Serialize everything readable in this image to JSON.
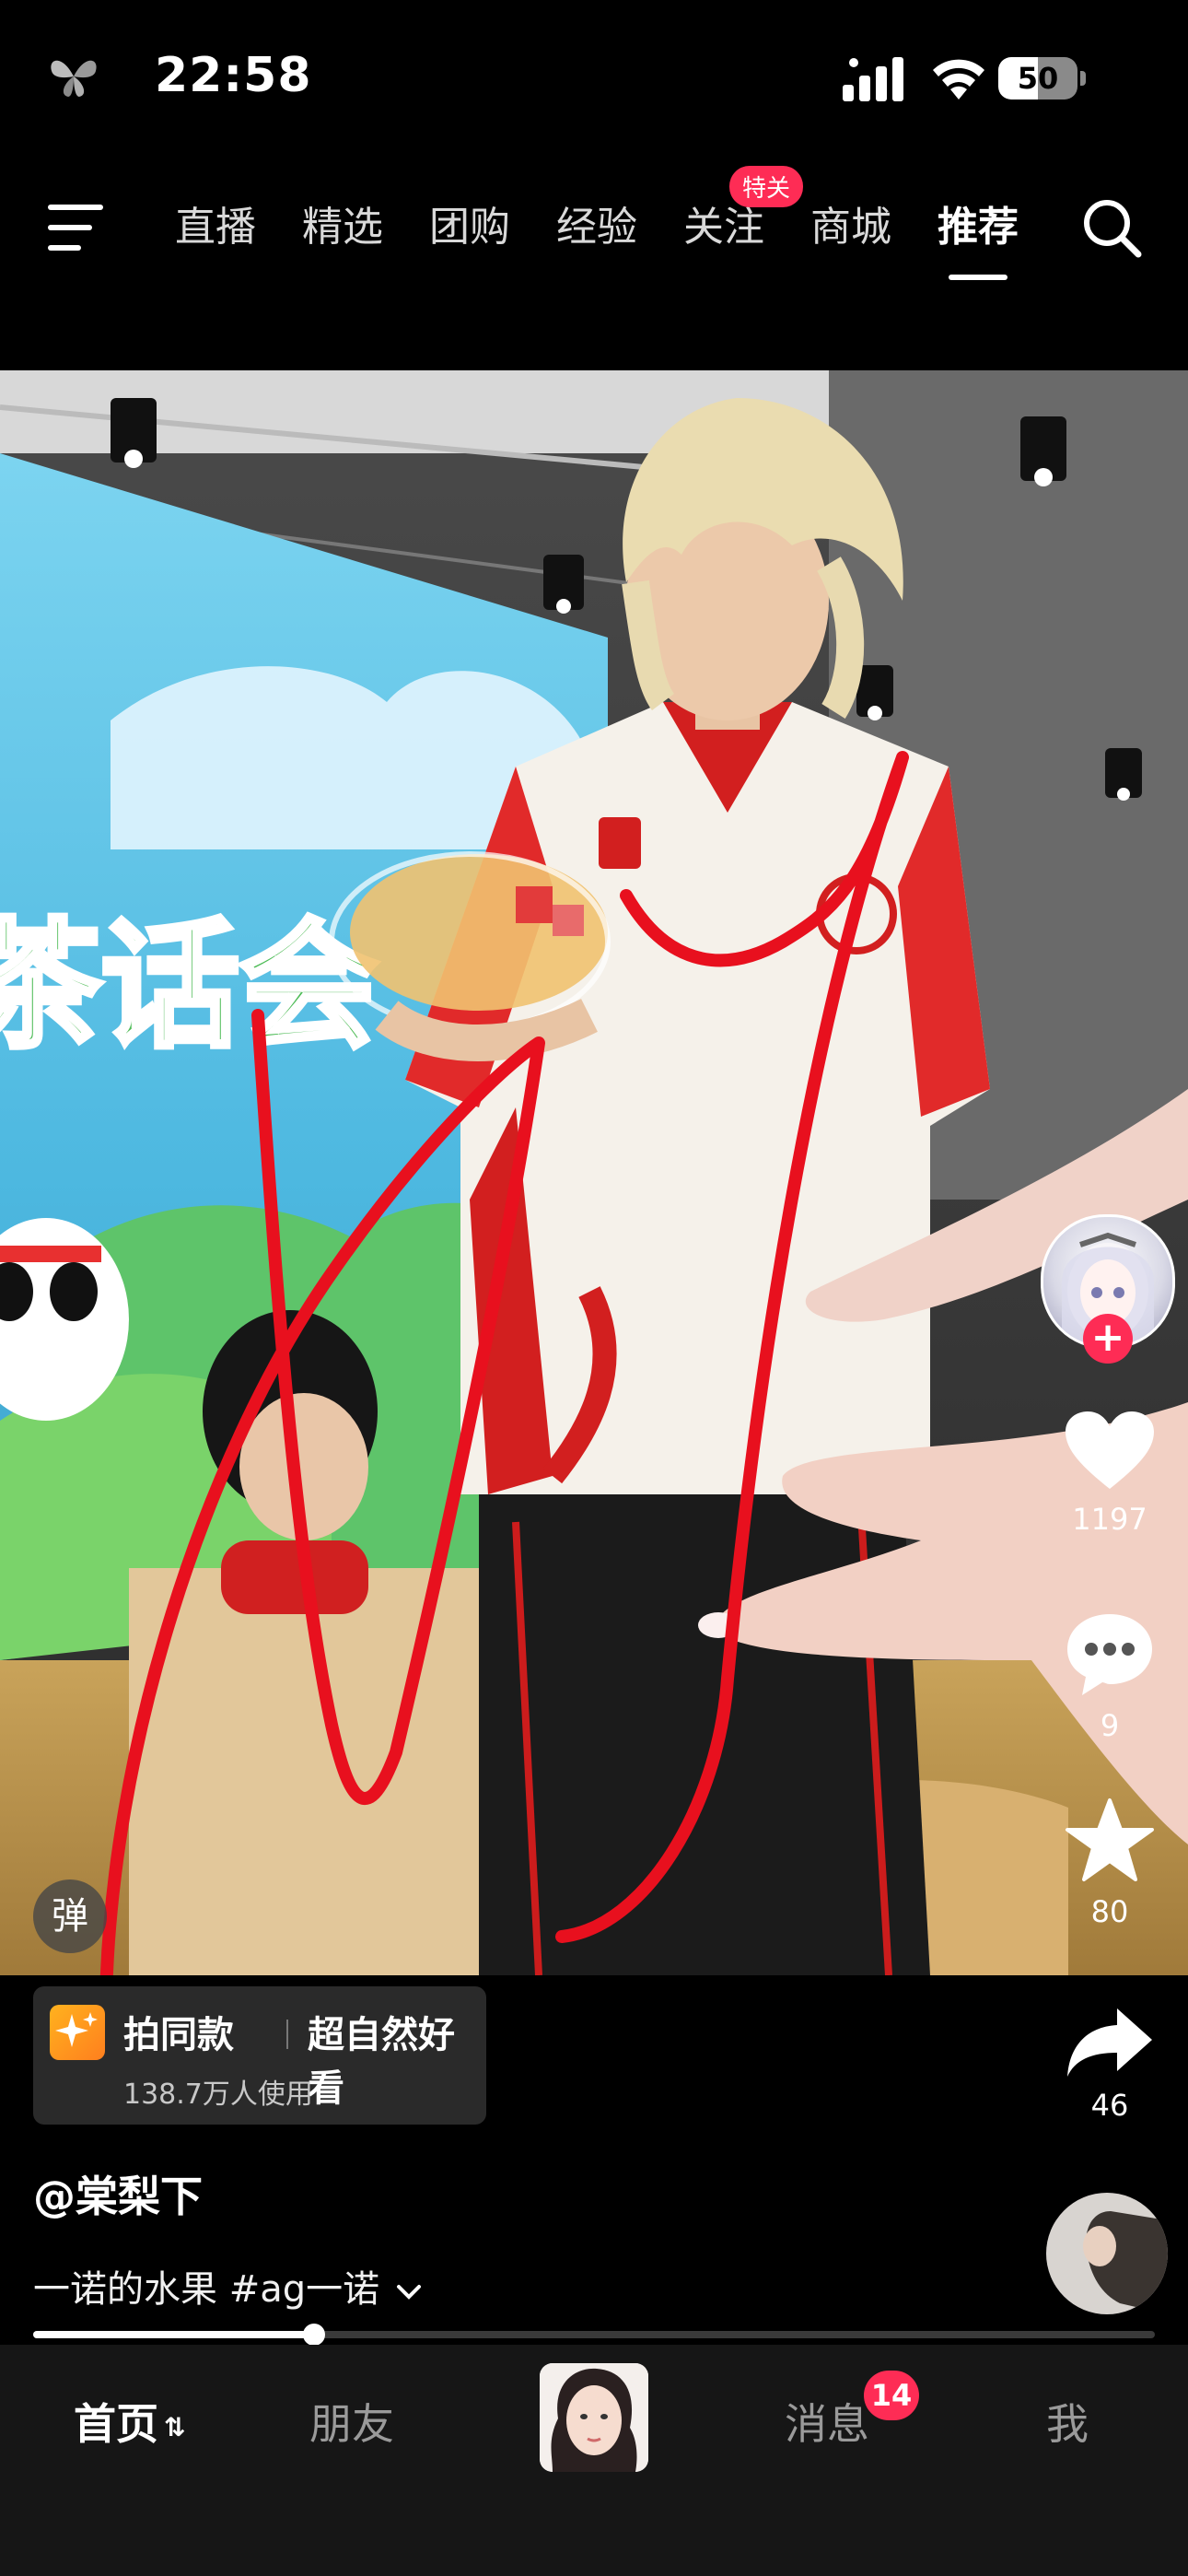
{
  "status_bar": {
    "time": "22:58",
    "battery_level": "50",
    "battery_fraction": 0.5,
    "icons": [
      "butterfly-icon",
      "signal-icon",
      "wifi-icon",
      "battery-icon"
    ]
  },
  "top_nav": {
    "menu_icon": "menu-icon",
    "tabs": [
      {
        "label": "直播"
      },
      {
        "label": "精选"
      },
      {
        "label": "团购"
      },
      {
        "label": "经验"
      },
      {
        "label": "关注",
        "badge": "特关"
      },
      {
        "label": "商城"
      },
      {
        "label": "推荐",
        "active": true
      }
    ],
    "search_icon": "search-icon"
  },
  "video": {
    "danmu_label": "弹",
    "scene_text": "茶话会"
  },
  "rail": {
    "likes": "1197",
    "comments": "9",
    "favorites": "80",
    "shares": "46"
  },
  "same_style": {
    "title": "拍同款",
    "effect_name": "超自然好看",
    "users": "138.7万人使用"
  },
  "post": {
    "author": "@棠梨下",
    "description": "一诺的水果 #ag一诺",
    "progress_fraction": 0.25
  },
  "bottom_bar": {
    "home": "首页",
    "home_suffix": "⇅",
    "friends": "朋友",
    "messages": "消息",
    "messages_badge": "14",
    "me": "我"
  },
  "colors": {
    "accent": "#fe2c55",
    "annotation": "#e8101e",
    "background": "#000000"
  }
}
